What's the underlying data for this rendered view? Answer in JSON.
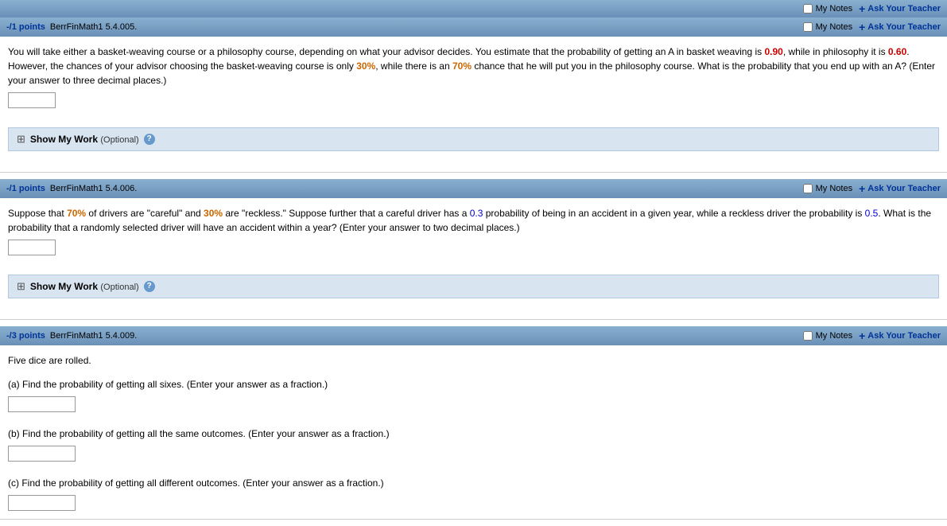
{
  "topbar": {
    "notes_label": "My Notes",
    "ask_teacher_label": "Ask Your Teacher"
  },
  "question1": {
    "points": "-/1 points",
    "id": "BerrFinMath1 5.4.005.",
    "notes_label": "My Notes",
    "ask_teacher_label": "Ask Your Teacher",
    "body_parts": [
      {
        "type": "text",
        "content": "You will take either a basket-weaving course or a philosophy course, depending on what your advisor decides. You estimate that the probability of getting an A in basket weaving is "
      },
      {
        "type": "highlight-red",
        "content": "0.90"
      },
      {
        "type": "text",
        "content": ", while in philosophy it is "
      },
      {
        "type": "highlight-red",
        "content": "0.60"
      },
      {
        "type": "text",
        "content": ". However, the chances of your advisor choosing the basket-weaving course is only "
      },
      {
        "type": "highlight-orange",
        "content": "30%"
      },
      {
        "type": "text",
        "content": ", while there is an "
      },
      {
        "type": "highlight-orange",
        "content": "70%"
      },
      {
        "type": "text",
        "content": " chance that he will put you in the philosophy course. What is the probability that you end up with an A? (Enter your answer to three decimal places.)"
      }
    ],
    "show_my_work": "Show My Work",
    "optional_label": "(Optional)"
  },
  "question2": {
    "points": "-/1 points",
    "id": "BerrFinMath1 5.4.006.",
    "notes_label": "My Notes",
    "ask_teacher_label": "Ask Your Teacher",
    "body_parts": [
      {
        "type": "text",
        "content": "Suppose that "
      },
      {
        "type": "highlight-orange",
        "content": "70%"
      },
      {
        "type": "text",
        "content": " of drivers are \"careful\" and "
      },
      {
        "type": "highlight-orange",
        "content": "30%"
      },
      {
        "type": "text",
        "content": " are \"reckless.\" Suppose further that a careful driver has a "
      },
      {
        "type": "highlight-blue",
        "content": "0.3"
      },
      {
        "type": "text",
        "content": " probability of being in an accident in a given year, while a reckless driver the probability is "
      },
      {
        "type": "highlight-blue",
        "content": "0.5"
      },
      {
        "type": "text",
        "content": ". What is the probability that a randomly selected driver will have an accident within a year? (Enter your answer to two decimal places.)"
      }
    ],
    "show_my_work": "Show My Work",
    "optional_label": "(Optional)"
  },
  "question3": {
    "points": "-/3 points",
    "id": "BerrFinMath1 5.4.009.",
    "notes_label": "My Notes",
    "ask_teacher_label": "Ask Your Teacher",
    "intro": "Five dice are rolled.",
    "sub_questions": [
      {
        "label": "(a) Find the probability of getting all sixes. (Enter your answer as a fraction.)"
      },
      {
        "label": "(b) Find the probability of getting all the same outcomes. (Enter your answer as a fraction.)"
      },
      {
        "label": "(c) Find the probability of getting all different outcomes. (Enter your answer as a fraction.)"
      }
    ]
  },
  "icons": {
    "checkbox": "☐",
    "plus": "+",
    "help": "?",
    "show_work": "⊡"
  }
}
